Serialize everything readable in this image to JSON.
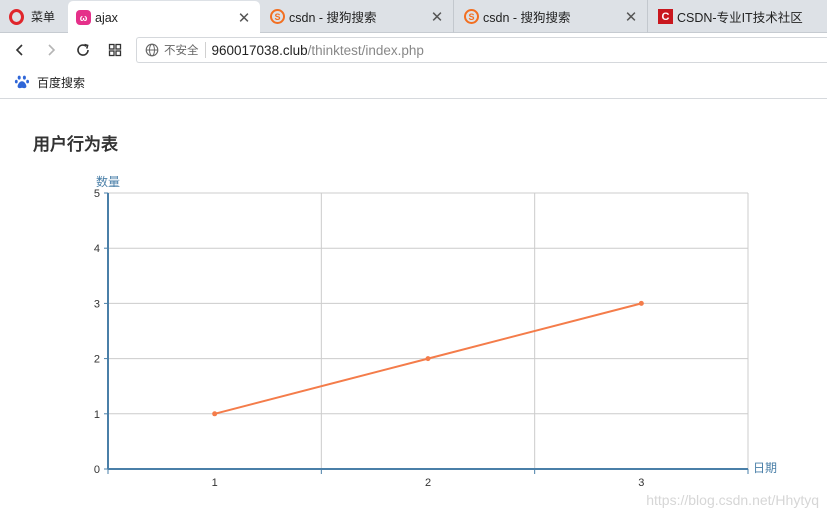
{
  "browser": {
    "menu_label": "菜单",
    "tabs": [
      {
        "title": "ajax",
        "favicon": "ajax-favicon",
        "active": true
      },
      {
        "title": "csdn - 搜狗搜索",
        "favicon": "sogou-favicon",
        "active": false
      },
      {
        "title": "csdn - 搜狗搜索",
        "favicon": "sogou-favicon",
        "active": false
      },
      {
        "title": "CSDN-专业IT技术社区",
        "favicon": "csdn-favicon",
        "active": false
      }
    ],
    "insecure_label": "不安全",
    "url_domain": "960017038.club",
    "url_path": "/thinktest/index.php",
    "bookmark_label": "百度搜索"
  },
  "page": {
    "heading": "用户行为表",
    "watermark": "https://blog.csdn.net/Hhytyq"
  },
  "chart_data": {
    "type": "line",
    "title": "用户行为表",
    "xlabel": "日期",
    "ylabel": "数量",
    "categories": [
      "1",
      "2",
      "3"
    ],
    "series": [
      {
        "values": [
          1,
          2,
          3
        ],
        "color": "#f47c4a"
      }
    ],
    "ylim": [
      0,
      5
    ],
    "yticks": [
      0,
      1,
      2,
      3,
      4,
      5
    ],
    "grid": true,
    "axis_color": "#4a7fa8"
  }
}
